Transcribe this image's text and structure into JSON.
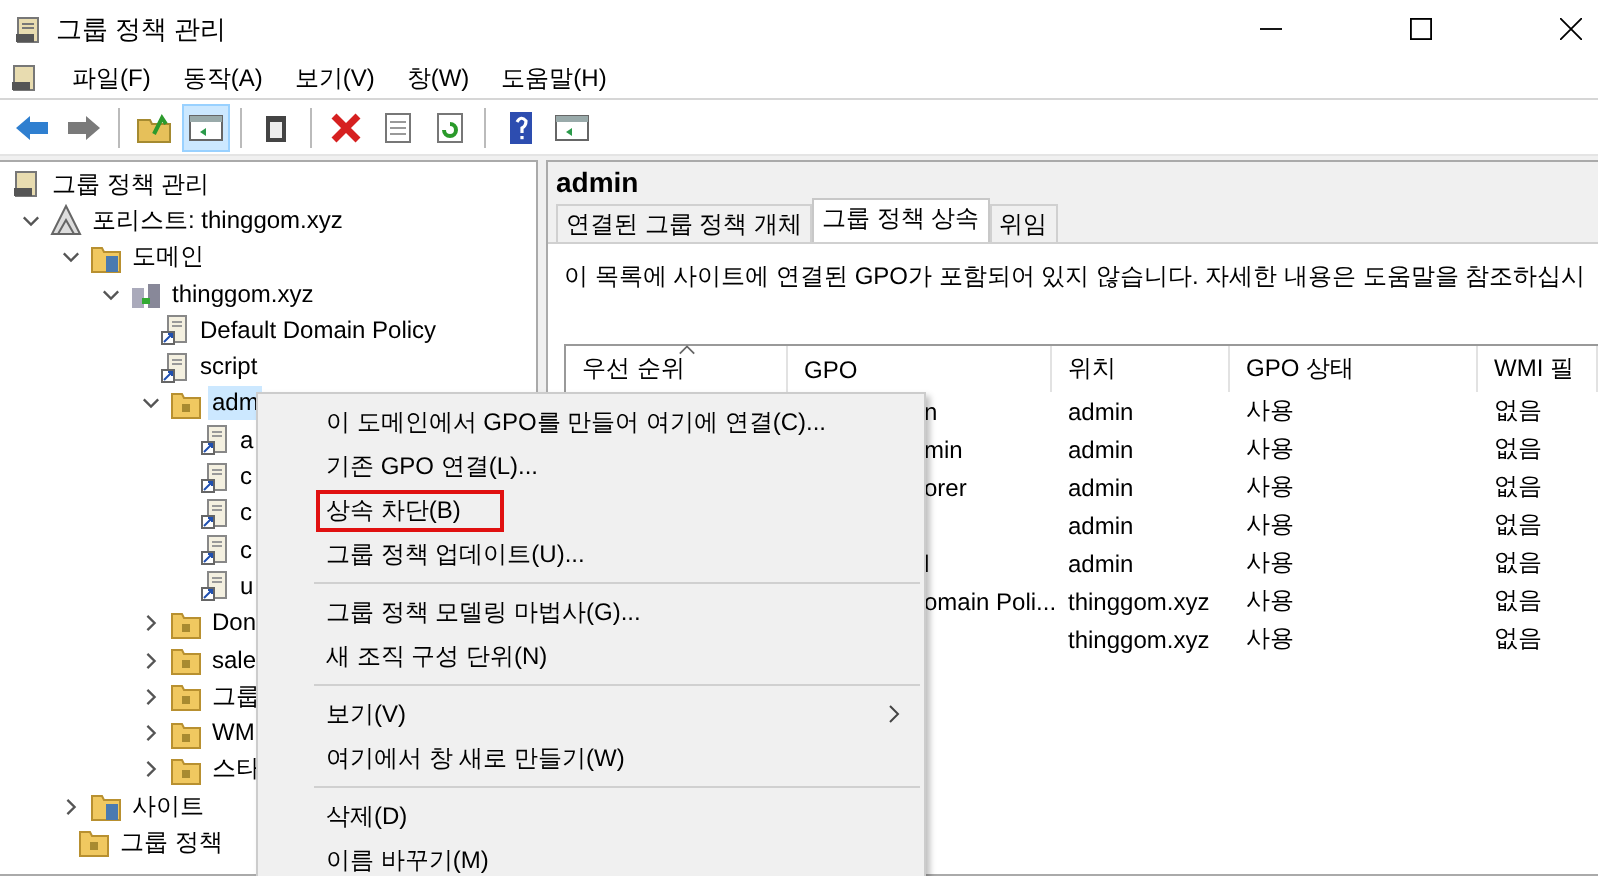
{
  "window": {
    "title": "그룹 정책 관리"
  },
  "menu_bar": [
    "파일(F)",
    "동작(A)",
    "보기(V)",
    "창(W)",
    "도움말(H)"
  ],
  "toolbar": [
    {
      "kind": "back",
      "pressed": false
    },
    {
      "kind": "forward",
      "pressed": false
    },
    {
      "kind": "sep"
    },
    {
      "kind": "up",
      "pressed": false
    },
    {
      "kind": "tree",
      "pressed": true
    },
    {
      "kind": "sep"
    },
    {
      "kind": "clipboard",
      "pressed": false
    },
    {
      "kind": "sep"
    },
    {
      "kind": "delete",
      "pressed": false
    },
    {
      "kind": "properties",
      "pressed": false
    },
    {
      "kind": "refresh",
      "pressed": false
    },
    {
      "kind": "sep"
    },
    {
      "kind": "help",
      "pressed": false
    },
    {
      "kind": "view",
      "pressed": false
    }
  ],
  "tree": [
    {
      "label": "그룹 정책 관리",
      "kind": "root",
      "selected": false,
      "children": [
        {
          "label": "포리스트: thinggom.xyz",
          "kind": "forest",
          "expanded": true,
          "selected": false,
          "children": [
            {
              "label": "도메인",
              "kind": "domains",
              "expanded": true,
              "selected": false,
              "children": [
                {
                  "label": "thinggom.xyz",
                  "kind": "domain",
                  "expanded": true,
                  "selected": false,
                  "children": [
                    {
                      "label": "Default Domain Policy",
                      "kind": "gpo",
                      "selected": false
                    },
                    {
                      "label": "script",
                      "kind": "gpo",
                      "selected": false
                    },
                    {
                      "label": "adm",
                      "kind": "ou",
                      "expanded": true,
                      "selected": true,
                      "children": [
                        {
                          "label": "a",
                          "kind": "gpo",
                          "selected": false
                        },
                        {
                          "label": "c",
                          "kind": "gpo",
                          "selected": false
                        },
                        {
                          "label": "c",
                          "kind": "gpo",
                          "selected": false
                        },
                        {
                          "label": "c",
                          "kind": "gpo",
                          "selected": false
                        },
                        {
                          "label": "u",
                          "kind": "gpo",
                          "selected": false
                        }
                      ]
                    },
                    {
                      "label": "Don",
                      "kind": "ou",
                      "expanded": false,
                      "selected": false
                    },
                    {
                      "label": "sale",
                      "kind": "ou",
                      "expanded": false,
                      "selected": false
                    },
                    {
                      "label": "그룹",
                      "kind": "gpo-folder",
                      "expanded": false,
                      "selected": false
                    },
                    {
                      "label": "WM",
                      "kind": "wmi-folder",
                      "expanded": false,
                      "selected": false
                    },
                    {
                      "label": "스타",
                      "kind": "starter-folder",
                      "expanded": false,
                      "selected": false
                    }
                  ]
                }
              ]
            },
            {
              "label": "사이트",
              "kind": "sites",
              "expanded": false,
              "selected": false
            },
            {
              "label": "그룹 정책",
              "kind": "modeling",
              "selected": false
            }
          ]
        }
      ]
    }
  ],
  "detail": {
    "heading": "admin",
    "tabs": [
      {
        "label": "연결된 그룹 정책 개체",
        "selected": false
      },
      {
        "label": "그룹 정책 상속",
        "selected": true
      },
      {
        "label": "위임",
        "selected": false
      }
    ],
    "message": "이 목록에 사이트에 연결된 GPO가 포함되어 있지 않습니다. 자세한 내용은 도움말을 참조하십시",
    "columns": [
      {
        "label": "우선 순위",
        "sorted": true
      },
      {
        "label": "GPO",
        "sorted": false
      },
      {
        "label": "위치",
        "sorted": false
      },
      {
        "label": "GPO 상태",
        "sorted": false
      },
      {
        "label": "WMI 필",
        "sorted": false
      }
    ],
    "rows": [
      {
        "gpo": "n",
        "location": "admin",
        "status": "사용",
        "wmi": "없음"
      },
      {
        "gpo": "min",
        "location": "admin",
        "status": "사용",
        "wmi": "없음"
      },
      {
        "gpo": "orer",
        "location": "admin",
        "status": "사용",
        "wmi": "없음"
      },
      {
        "location": "admin",
        "status": "사용",
        "wmi": "없음"
      },
      {
        "gpo": "l",
        "location": "admin",
        "status": "사용",
        "wmi": "없음"
      },
      {
        "gpo": "omain Poli...",
        "location": "thinggom.xyz",
        "status": "사용",
        "wmi": "없음"
      },
      {
        "location": "thinggom.xyz",
        "status": "사용",
        "wmi": "없음"
      }
    ]
  },
  "context_menu": [
    {
      "kind": "item",
      "label": "이 도메인에서 GPO를 만들어 여기에 연결(C)...",
      "submenu": false,
      "highlighted": false
    },
    {
      "kind": "item",
      "label": "기존 GPO 연결(L)...",
      "submenu": false,
      "highlighted": false
    },
    {
      "kind": "item",
      "label": "상속 차단(B)",
      "submenu": false,
      "highlighted": true
    },
    {
      "kind": "item",
      "label": "그룹 정책 업데이트(U)...",
      "submenu": false,
      "highlighted": false
    },
    {
      "kind": "separator"
    },
    {
      "kind": "item",
      "label": "그룹 정책 모델링 마법사(G)...",
      "submenu": false,
      "highlighted": false
    },
    {
      "kind": "item",
      "label": "새 조직 구성 단위(N)",
      "submenu": false,
      "highlighted": false
    },
    {
      "kind": "separator"
    },
    {
      "kind": "item",
      "label": "보기(V)",
      "submenu": true,
      "highlighted": false
    },
    {
      "kind": "item",
      "label": "여기에서 창 새로 만들기(W)",
      "submenu": false,
      "highlighted": false
    },
    {
      "kind": "separator"
    },
    {
      "kind": "item",
      "label": "삭제(D)",
      "submenu": false,
      "highlighted": false
    },
    {
      "kind": "item",
      "label": "이름 바꾸기(M)",
      "submenu": false,
      "highlighted": false
    }
  ]
}
